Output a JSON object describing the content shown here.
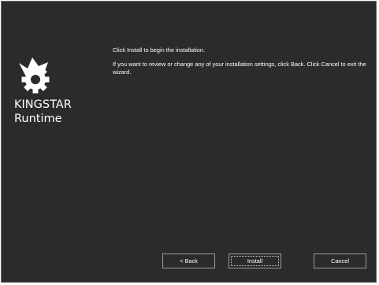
{
  "product": {
    "line1": "KINGSTAR",
    "line2": "Runtime",
    "logo_icon": "crown-gear-icon"
  },
  "content": {
    "paragraph1": "Click Install to begin the installation.",
    "paragraph2": "If you want to review or change any of your installation settings, click Back. Click Cancel to exit the wizard."
  },
  "buttons": {
    "back_label": "< Back",
    "install_label": "Install",
    "cancel_label": "Cancel"
  },
  "colors": {
    "background": "#2b2b2b",
    "text": "#ffffff",
    "button_border": "#9a9a9a"
  }
}
